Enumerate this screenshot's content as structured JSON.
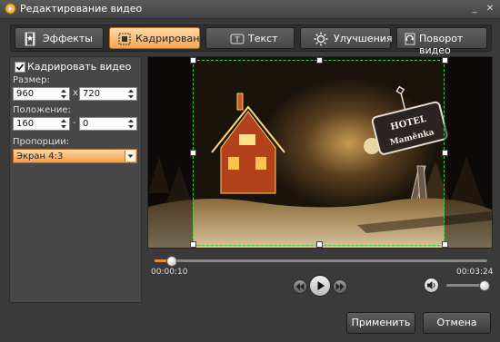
{
  "window": {
    "title": "Редактирование видео",
    "minimize_label": "_",
    "close_label": "✕"
  },
  "tabs": [
    {
      "label": "Эффекты",
      "icon": "film-effects-icon",
      "active": false
    },
    {
      "label": "Кадрирование",
      "icon": "crop-icon",
      "active": true
    },
    {
      "label": "Текст",
      "icon": "text-icon",
      "active": false
    },
    {
      "label": "Улучшения",
      "icon": "sun-brightness-icon",
      "active": false
    },
    {
      "label": "Поворот видео",
      "icon": "rotate-film-icon",
      "active": false
    }
  ],
  "crop": {
    "enable_label": "Кадрировать видео",
    "enabled": true,
    "size_label": "Размер:",
    "width": "960",
    "height": "720",
    "size_sep": "x",
    "position_label": "Положение:",
    "pos_x": "160",
    "pos_y": "0",
    "pos_sep": "-",
    "ratio_label": "Пропорции:",
    "ratio_value": "Экран 4:3"
  },
  "preview": {
    "hotel_line1": "HOTEL",
    "hotel_line2": "Mamĕnka"
  },
  "player": {
    "current_time": "00:00:10",
    "total_time": "00:03:24",
    "progress": 0.05,
    "volume": 0.9
  },
  "buttons": {
    "apply": "Применить",
    "cancel": "Отмена"
  },
  "colors": {
    "accent": "#f5a756",
    "crop_frame": "#32d24a",
    "progress": "#f08a2a"
  }
}
